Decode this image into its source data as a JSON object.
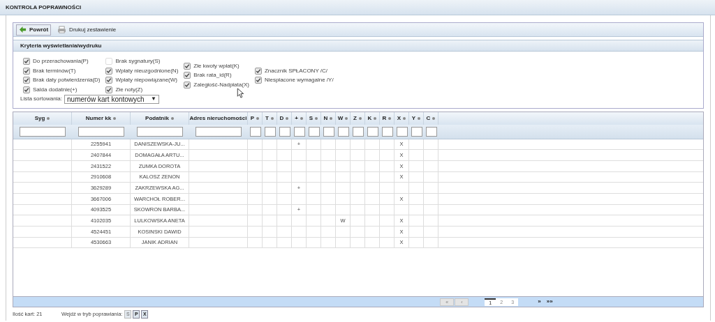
{
  "title": "KONTROLA POPRAWNOŚCI",
  "toolbar": [
    {
      "kind": "back",
      "label": "Powrót"
    },
    {
      "kind": "print",
      "label": "Drukuj zestawienie"
    }
  ],
  "criteria": {
    "title": "Kryteria wyświetlania/wydruku",
    "columns": [
      [
        {
          "label": "Do przerachowania(P)",
          "checked": true
        },
        {
          "label": "Brak terminów(T)",
          "checked": true
        },
        {
          "label": "Brak daty potwierdzenia(D)",
          "checked": true
        },
        {
          "label": "Salda dodatnie(+)",
          "checked": true
        }
      ],
      [
        {
          "label": "Brak sygnatury(S)",
          "checked": false
        },
        {
          "label": "Wpłaty nieuzgodnione(N)",
          "checked": true
        },
        {
          "label": "Wpłaty niepowiązane(W)",
          "checked": true
        },
        {
          "label": "Złe noty(Z)",
          "checked": true
        }
      ],
      [
        {
          "label": "Złe kwoty wpłat(K)",
          "checked": true
        },
        {
          "label": "Brak rata_id(R)",
          "checked": true
        },
        {
          "label": "Zaległość-Nadpłata(X)",
          "checked": true
        }
      ],
      [
        {
          "label": "Znacznik SPŁACONY /C/",
          "checked": true
        },
        {
          "label": "Niespłacone wymagalne /Y/",
          "checked": true
        }
      ]
    ],
    "sort_label": "Lista sortowania:",
    "sort_value": "numerów kart kontowych",
    "sort_arrow": "▼"
  },
  "table": {
    "columns": [
      {
        "label": "Syg",
        "kind": "wide",
        "sortable": true
      },
      {
        "label": "Numer kk",
        "kind": "wide",
        "sortable": true
      },
      {
        "label": "Podatnik",
        "kind": "wide",
        "sortable": true
      },
      {
        "label": "Adres nieruchomości",
        "kind": "wide",
        "sortable": false
      },
      {
        "label": "P",
        "kind": "flag",
        "sortable": true
      },
      {
        "label": "T",
        "kind": "flag",
        "sortable": true
      },
      {
        "label": "D",
        "kind": "flag",
        "sortable": true
      },
      {
        "label": "+",
        "kind": "flag",
        "sortable": true
      },
      {
        "label": "S",
        "kind": "flag",
        "sortable": true
      },
      {
        "label": "N",
        "kind": "flag",
        "sortable": true
      },
      {
        "label": "W",
        "kind": "flag",
        "sortable": true
      },
      {
        "label": "Z",
        "kind": "flag",
        "sortable": true
      },
      {
        "label": "K",
        "kind": "flag",
        "sortable": true
      },
      {
        "label": "R",
        "kind": "flag",
        "sortable": true
      },
      {
        "label": "X",
        "kind": "flag",
        "sortable": true
      },
      {
        "label": "Y",
        "kind": "flag",
        "sortable": true
      },
      {
        "label": "C",
        "kind": "flag",
        "sortable": true
      }
    ],
    "rows": [
      {
        "cells": {
          "1": "2255941",
          "2": "DANISZEWSKA-JU...",
          "7": "+",
          "14": "X"
        }
      },
      {
        "cells": {
          "1": "2407844",
          "2": "DOMAGAŁA ARTU...",
          "14": "X"
        }
      },
      {
        "cells": {
          "1": "2431522",
          "2": "ZUMKA DOROTA",
          "14": "X"
        }
      },
      {
        "cells": {
          "1": "2910608",
          "2": "KALOSZ ZENON",
          "14": "X"
        }
      },
      {
        "cells": {
          "1": "3629289",
          "2": "ZAKRZEWSKA AG...",
          "7": "+"
        }
      },
      {
        "cells": {
          "1": "3667006",
          "2": "WARCHOŁ ROBER...",
          "14": "X"
        }
      },
      {
        "cells": {
          "1": "4093525",
          "2": "SKOWRON BARBA...",
          "7": "+"
        }
      },
      {
        "cells": {
          "1": "4102035",
          "2": "LULKOWSKA ANETA",
          "10": "W",
          "14": "X"
        }
      },
      {
        "cells": {
          "1": "4524451",
          "2": "KOSINSKI DAWID",
          "14": "X"
        }
      },
      {
        "cells": {
          "1": "4530663",
          "2": "JANIK ADRIAN",
          "14": "X"
        }
      }
    ]
  },
  "pager": {
    "first": {
      "label": "«",
      "disabled": true
    },
    "prev": {
      "label": "‹",
      "disabled": true
    },
    "pages": [
      {
        "label": "1",
        "selected": true
      },
      {
        "label": "2",
        "selected": false
      },
      {
        "label": "3",
        "selected": false
      }
    ],
    "next": {
      "label": "»",
      "disabled": false
    },
    "last": {
      "label": "»»",
      "disabled": false
    }
  },
  "footer": {
    "count": "Ilość kart: 21",
    "mode_label": "Wejdź w tryb poprawiania:",
    "mode_buttons": [
      {
        "label": "S",
        "disabled": true
      },
      {
        "label": "P",
        "disabled": false
      },
      {
        "label": "X",
        "disabled": false
      }
    ]
  }
}
